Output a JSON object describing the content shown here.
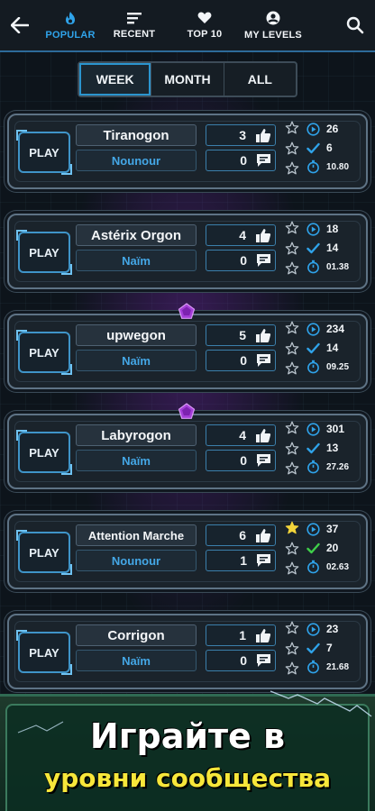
{
  "nav": {
    "tabs": [
      {
        "label": "POPULAR",
        "icon": "flame-icon",
        "active": true
      },
      {
        "label": "RECENT",
        "icon": "lines-icon",
        "active": false
      },
      {
        "label": "TOP 10",
        "icon": "heart-icon",
        "active": false
      },
      {
        "label": "MY LEVELS",
        "icon": "user-icon",
        "active": false
      }
    ]
  },
  "period": {
    "options": [
      "WEEK",
      "MONTH",
      "ALL"
    ],
    "selected": "WEEK"
  },
  "play_label": "PLAY",
  "levels": [
    {
      "name": "Tiranogon",
      "author": "Nounour",
      "likes": "3",
      "comments": "0",
      "plays": "26",
      "completions": "6",
      "time": "10.80",
      "stars_filled": 0,
      "featured": false
    },
    {
      "name": "Astérix Orgon",
      "author": "Naïm",
      "likes": "4",
      "comments": "0",
      "plays": "18",
      "completions": "14",
      "time": "01.38",
      "stars_filled": 0,
      "featured": false
    },
    {
      "name": "upwegon",
      "author": "Naïm",
      "likes": "5",
      "comments": "0",
      "plays": "234",
      "completions": "14",
      "time": "09.25",
      "stars_filled": 0,
      "featured": true
    },
    {
      "name": "Labyrogon",
      "author": "Naïm",
      "likes": "4",
      "comments": "0",
      "plays": "301",
      "completions": "13",
      "time": "27.26",
      "stars_filled": 0,
      "featured": true
    },
    {
      "name": "Attention Marche",
      "author": "Nounour",
      "likes": "6",
      "comments": "1",
      "plays": "37",
      "completions": "20",
      "time": "02.63",
      "stars_filled": 1,
      "featured": false
    },
    {
      "name": "Corrigon",
      "author": "Naïm",
      "likes": "1",
      "comments": "0",
      "plays": "23",
      "completions": "7",
      "time": "21.68",
      "stars_filled": 0,
      "featured": false
    }
  ],
  "banner": {
    "line1": "Играйте в",
    "line2": "уровни сообщества"
  },
  "colors": {
    "accent": "#2fa3ea",
    "star_filled": "#f2d43a",
    "check_highlight": "#3fcf4a",
    "gem": "#a43fd8",
    "banner_text_yellow": "#f7e73a"
  }
}
